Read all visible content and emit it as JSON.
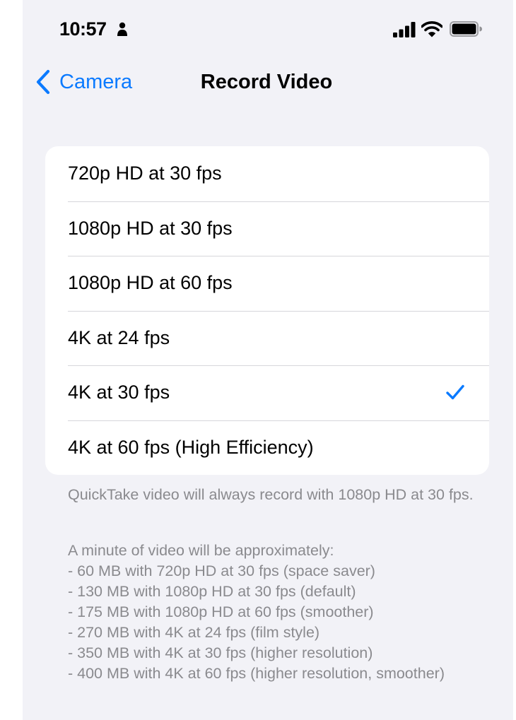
{
  "status_bar": {
    "time": "10:57",
    "icons": [
      "person-icon",
      "signal-icon",
      "wifi-icon",
      "battery-icon"
    ]
  },
  "nav": {
    "back_label": "Camera",
    "title": "Record Video"
  },
  "options": [
    {
      "label": "720p HD at 30 fps",
      "selected": false
    },
    {
      "label": "1080p HD at 30 fps",
      "selected": false
    },
    {
      "label": "1080p HD at 60 fps",
      "selected": false
    },
    {
      "label": "4K at 24 fps",
      "selected": false
    },
    {
      "label": "4K at 30 fps",
      "selected": true
    },
    {
      "label": "4K at 60 fps (High Efficiency)",
      "selected": false
    }
  ],
  "footer": {
    "quicktake_note": "QuickTake video will always record with 1080p HD at 30 fps.",
    "size_intro": "A minute of video will be approximately:",
    "size_items": [
      "- 60 MB with 720p HD at 30 fps (space saver)",
      "- 130 MB with 1080p HD at 30 fps (default)",
      "- 175 MB with 1080p HD at 60 fps (smoother)",
      "- 270 MB with 4K at 24 fps (film style)",
      "- 350 MB with 4K at 30 fps (higher resolution)",
      "- 400 MB with 4K at 60 fps (higher resolution, smoother)"
    ]
  },
  "colors": {
    "accent": "#0a7aff",
    "background": "#f2f2f7",
    "card": "#ffffff",
    "secondary_text": "#8a8a8e",
    "separator": "#d6d6db"
  }
}
